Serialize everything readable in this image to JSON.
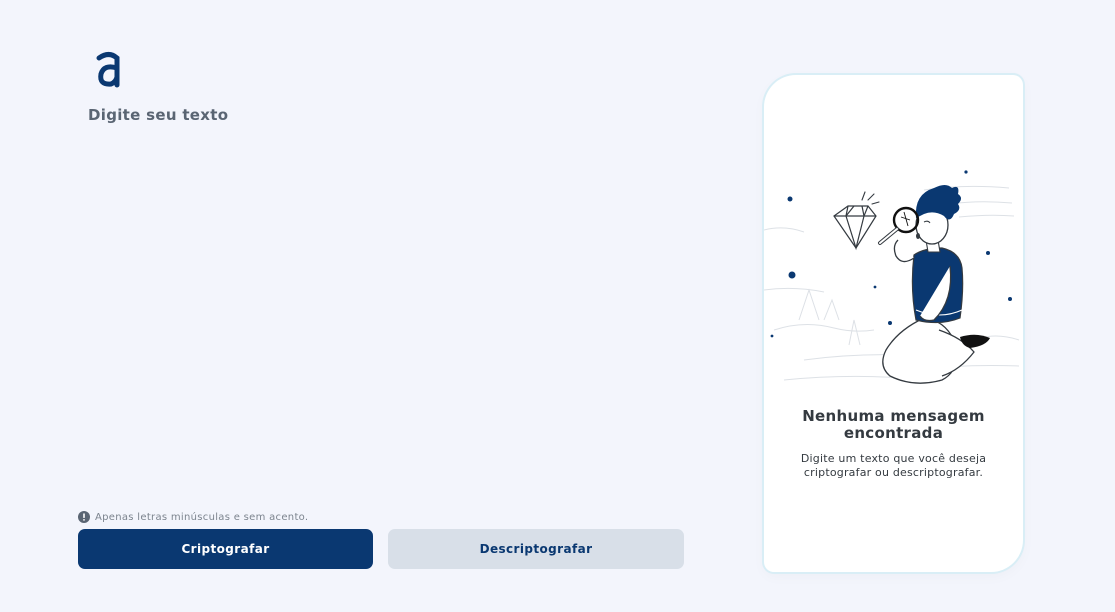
{
  "app": {
    "logo_icon": "alura-logo-icon",
    "accent_color": "#0a3871",
    "background_color": "#f3f5fc"
  },
  "input": {
    "placeholder": "Digite seu texto",
    "value": ""
  },
  "hint": {
    "icon": "info-circle-icon",
    "text": "Apenas letras minúsculas e sem acento."
  },
  "buttons": {
    "encrypt_label": "Criptografar",
    "decrypt_label": "Descriptografar"
  },
  "output": {
    "illustration": "person-with-magnifier-illustration",
    "title": "Nenhuma mensagem encontrada",
    "message": "Digite um texto que você deseja criptografar ou descriptografar."
  }
}
